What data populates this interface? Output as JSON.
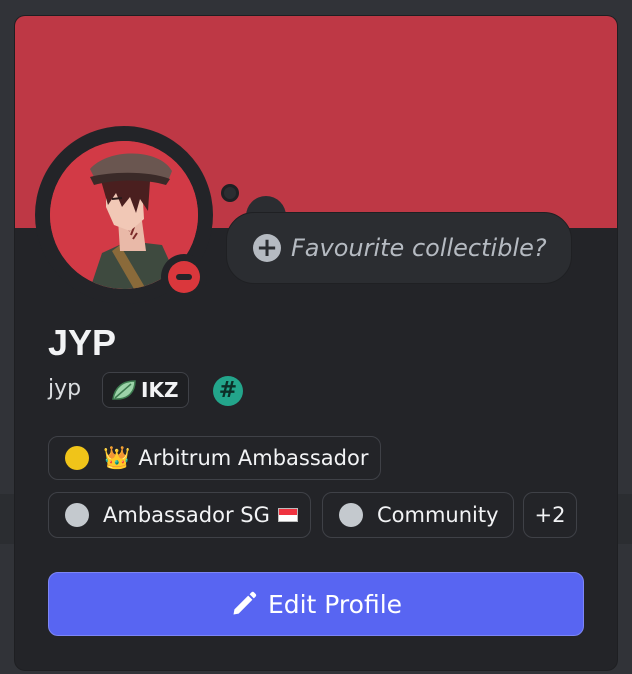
{
  "profile": {
    "display_name": "JYP",
    "username": "jyp",
    "server_tag": "IKZ",
    "status": "Do Not Disturb",
    "banner_color": "#be3845",
    "avatar_icon": "anime-character-avatar"
  },
  "collectible": {
    "prompt": "Favourite collectible?",
    "icon": "plus-circle-icon"
  },
  "roles": [
    {
      "dot_color": "#f0c419",
      "emoji": "👑",
      "label": "Arbitrum Ambassador"
    },
    {
      "dot_color": "#c4c9ce",
      "label": "Ambassador SG",
      "flag": "singapore-flag-icon"
    },
    {
      "dot_color": "#c4c9ce",
      "label": "Community"
    }
  ],
  "more_roles": "+2",
  "edit_button": {
    "label": "Edit Profile",
    "icon": "pencil-icon",
    "color": "#5865f2"
  }
}
